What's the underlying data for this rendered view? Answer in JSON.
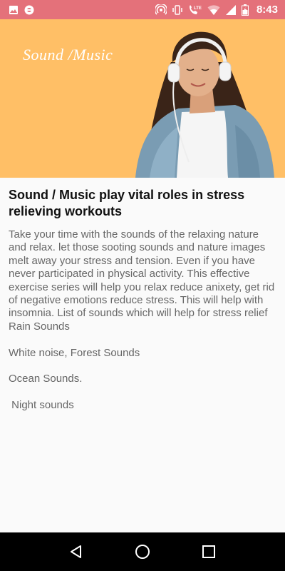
{
  "status_bar": {
    "time": "8:43",
    "network_label": "LTE",
    "icons": [
      "image-icon",
      "record-icon",
      "hotspot-icon",
      "vibrate-icon",
      "lte-call-icon",
      "wifi-icon",
      "signal-icon",
      "battery-icon"
    ],
    "background": "#e4717a"
  },
  "hero": {
    "title": "Sound /Music",
    "background": "#ffbf66"
  },
  "article": {
    "heading": "Sound / Music play vital roles in stress relieving workouts",
    "body": "Take your time with the sounds of the relaxing nature and relax. let those sooting sounds and nature images melt away your stress and tension. Even if you have never participated in physical activity. This effective exercise series will help you relax reduce anixety, get rid of negative emotions reduce stress. This will help with insomnia. List of sounds which will help for stress relief",
    "sounds": [
      "Rain Sounds",
      "White noise, Forest Sounds",
      "Ocean Sounds.",
      " Night sounds"
    ]
  },
  "nav_bar": {
    "buttons": [
      "back-icon",
      "home-icon",
      "recents-icon"
    ]
  }
}
